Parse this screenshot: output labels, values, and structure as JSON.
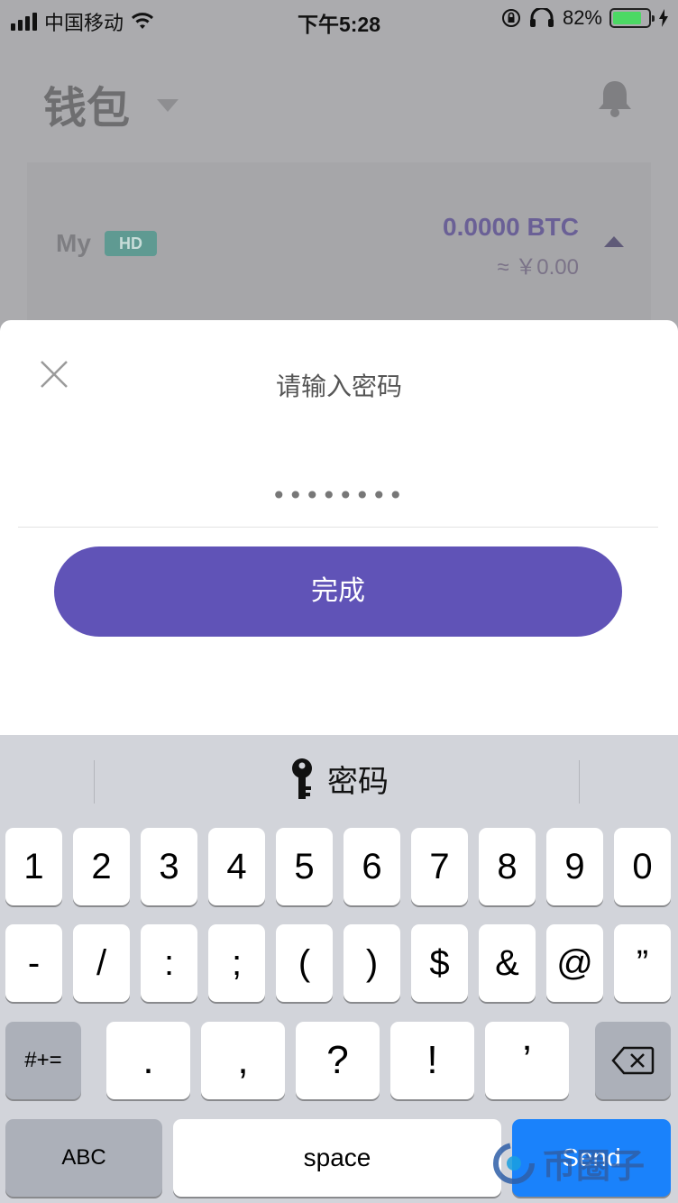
{
  "status_bar": {
    "carrier": "中国移动",
    "time": "下午5:28",
    "battery": "82%",
    "battery_level": 0.82
  },
  "wallet_header": {
    "title": "钱包"
  },
  "wallet_card": {
    "name": "My",
    "badge": "HD",
    "btc_balance": "0.0000 BTC",
    "cny_balance": "≈ ￥0.00"
  },
  "password_sheet": {
    "title": "请输入密码",
    "password_value": "••••••••",
    "done_label": "完成"
  },
  "keyboard": {
    "suggestion_label": "密码",
    "row1": [
      "1",
      "2",
      "3",
      "4",
      "5",
      "6",
      "7",
      "8",
      "9",
      "0"
    ],
    "row2": [
      "-",
      "/",
      ":",
      ";",
      "(",
      ")",
      "$",
      "&",
      "@",
      "”"
    ],
    "row3_mode": "#+=",
    "row3": [
      ".",
      ",",
      "?",
      "!",
      "’"
    ],
    "abc_label": "ABC",
    "space_label": "space",
    "send_label": "Send"
  },
  "watermark": {
    "text": "币圈子"
  },
  "colors": {
    "accent": "#6053b7",
    "send_key": "#1a82fb",
    "badge": "#5f9a92",
    "keyboard_bg": "#d2d4da"
  }
}
